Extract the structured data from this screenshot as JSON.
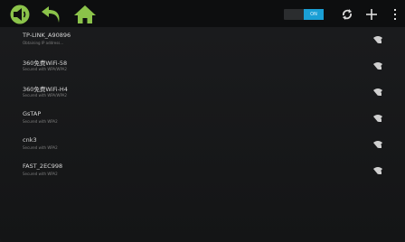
{
  "colors": {
    "accent_green": "#8bc34a",
    "toggle_blue": "#1a9fd5",
    "background": "#161718"
  },
  "topbar": {
    "nav_icons": [
      "volume-icon",
      "back-icon",
      "home-icon"
    ],
    "wifi_toggle": {
      "state_label": "ON",
      "on": true
    },
    "actions": [
      "scan-icon",
      "add-network-icon",
      "overflow-menu-icon"
    ]
  },
  "networks": [
    {
      "ssid": "TP-LINK_A90896",
      "status": "Obtaining IP address..."
    },
    {
      "ssid": "360免费WiFi-58",
      "status": "Secured with WPA/WPA2"
    },
    {
      "ssid": "360免费WiFi-H4",
      "status": "Secured with WPA/WPA2"
    },
    {
      "ssid": "GsTAP",
      "status": "Secured with WPA2"
    },
    {
      "ssid": "cnk3",
      "status": "Secured with WPA2"
    },
    {
      "ssid": "FAST_2EC998",
      "status": "Secured with WPA2"
    }
  ]
}
